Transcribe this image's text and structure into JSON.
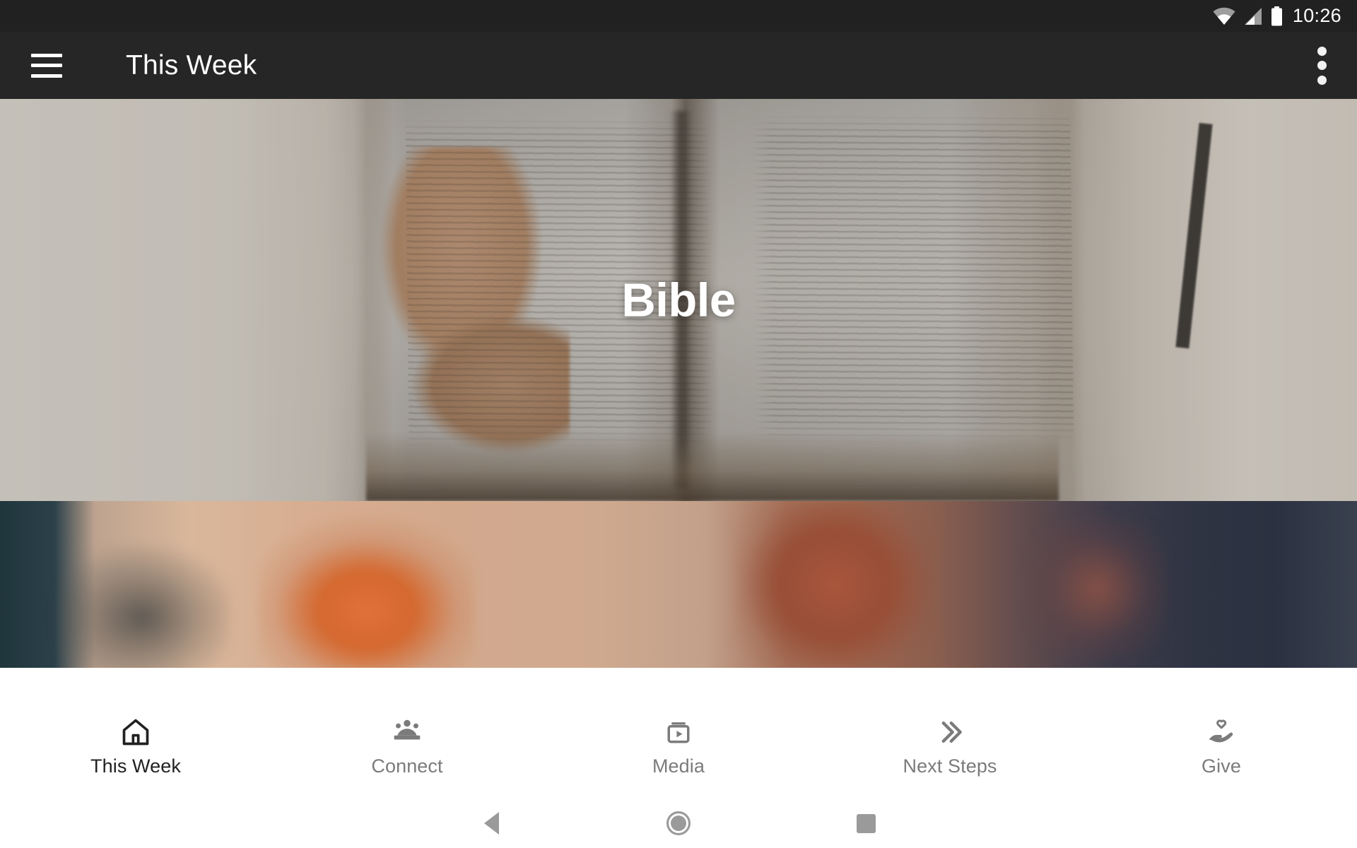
{
  "status_bar": {
    "time": "10:26",
    "icons": [
      "wifi-icon",
      "cellular-signal-icon",
      "battery-icon"
    ]
  },
  "toolbar": {
    "menu_icon": "hamburger-menu-icon",
    "title": "This Week",
    "overflow_icon": "overflow-menu-icon",
    "background_color": "#262626"
  },
  "cards": [
    {
      "title": "Bible",
      "image": "open-bible-on-white-blanket-photo"
    },
    {
      "title": "",
      "image": "sunset-clouds-photo"
    }
  ],
  "bottom_nav": {
    "items": [
      {
        "label": "This Week",
        "icon": "home-icon",
        "active": true
      },
      {
        "label": "Connect",
        "icon": "people-group-icon",
        "active": false
      },
      {
        "label": "Media",
        "icon": "video-library-icon",
        "active": false
      },
      {
        "label": "Next Steps",
        "icon": "double-chevron-right-icon",
        "active": false
      },
      {
        "label": "Give",
        "icon": "hand-heart-icon",
        "active": false
      }
    ],
    "active_color": "#212121",
    "inactive_color": "#7b7b7b"
  },
  "system_nav": {
    "back_label": "Back",
    "home_label": "Home",
    "recents_label": "Recent apps"
  }
}
